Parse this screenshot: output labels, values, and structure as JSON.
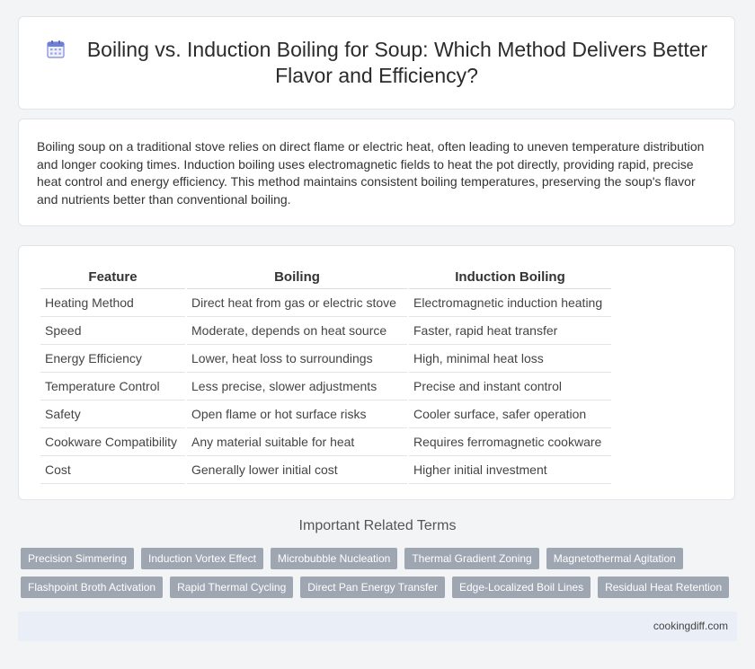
{
  "header": {
    "title": "Boiling vs. Induction Boiling for Soup: Which Method Delivers Better Flavor and Efficiency?",
    "icon": "calendar-icon"
  },
  "intro": {
    "text": "Boiling soup on a traditional stove relies on direct flame or electric heat, often leading to uneven temperature distribution and longer cooking times. Induction boiling uses electromagnetic fields to heat the pot directly, providing rapid, precise heat control and energy efficiency. This method maintains consistent boiling temperatures, preserving the soup's flavor and nutrients better than conventional boiling."
  },
  "table": {
    "headers": [
      "Feature",
      "Boiling",
      "Induction Boiling"
    ],
    "rows": [
      [
        "Heating Method",
        "Direct heat from gas or electric stove",
        "Electromagnetic induction heating"
      ],
      [
        "Speed",
        "Moderate, depends on heat source",
        "Faster, rapid heat transfer"
      ],
      [
        "Energy Efficiency",
        "Lower, heat loss to surroundings",
        "High, minimal heat loss"
      ],
      [
        "Temperature Control",
        "Less precise, slower adjustments",
        "Precise and instant control"
      ],
      [
        "Safety",
        "Open flame or hot surface risks",
        "Cooler surface, safer operation"
      ],
      [
        "Cookware Compatibility",
        "Any material suitable for heat",
        "Requires ferromagnetic cookware"
      ],
      [
        "Cost",
        "Generally lower initial cost",
        "Higher initial investment"
      ]
    ]
  },
  "related": {
    "heading": "Important Related Terms",
    "tags": [
      "Precision Simmering",
      "Induction Vortex Effect",
      "Microbubble Nucleation",
      "Thermal Gradient Zoning",
      "Magnetothermal Agitation",
      "Flashpoint Broth Activation",
      "Rapid Thermal Cycling",
      "Direct Pan Energy Transfer",
      "Edge-Localized Boil Lines",
      "Residual Heat Retention"
    ]
  },
  "footer": {
    "site": "cookingdiff.com"
  },
  "colors": {
    "tag_bg": "#9ea6b2",
    "footer_bg": "#e9eef7",
    "page_bg": "#f3f4f6"
  }
}
